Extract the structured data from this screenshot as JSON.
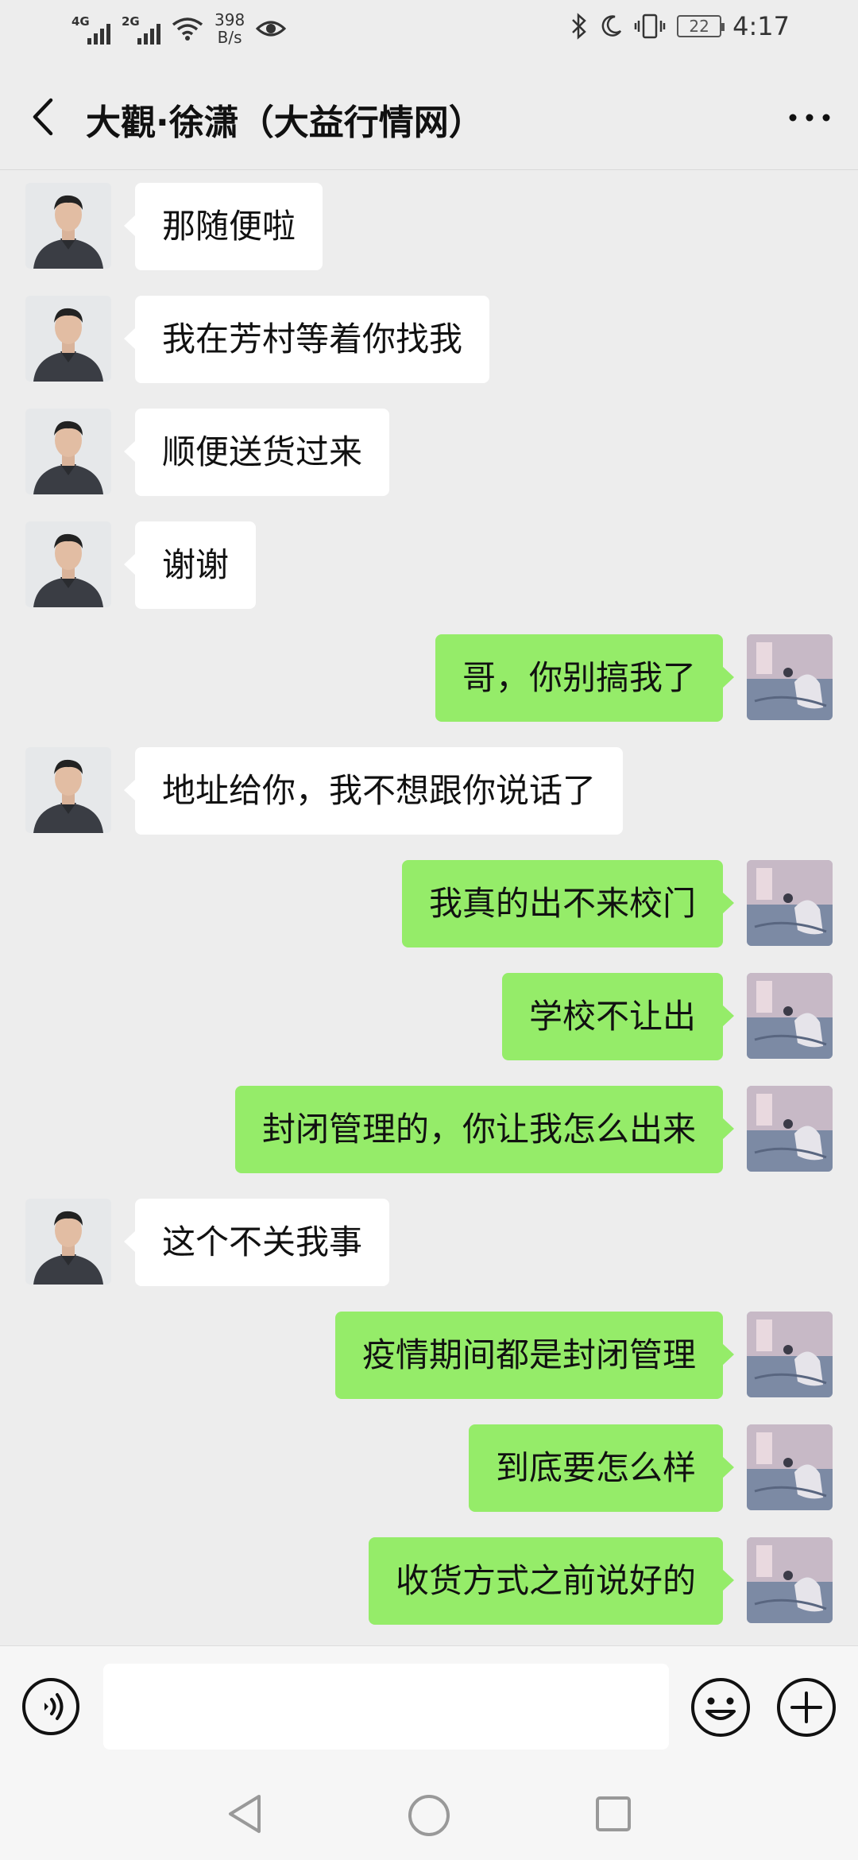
{
  "status_bar": {
    "network_1": "4G",
    "network_2": "2G",
    "speed_value": "398",
    "speed_unit": "B/s",
    "battery": "22",
    "time": "4:17"
  },
  "header": {
    "title": "大觀·徐潇（大益行情网）",
    "back_icon": "chevron-left-icon",
    "more_icon": "more-dots-icon"
  },
  "messages": [
    {
      "side": "left",
      "text": "那随便啦"
    },
    {
      "side": "left",
      "text": "我在芳村等着你找我"
    },
    {
      "side": "left",
      "text": "顺便送货过来"
    },
    {
      "side": "left",
      "text": "谢谢"
    },
    {
      "side": "right",
      "text": "哥，你别搞我了"
    },
    {
      "side": "left",
      "text": "地址给你，我不想跟你说话了"
    },
    {
      "side": "right",
      "text": "我真的出不来校门"
    },
    {
      "side": "right",
      "text": "学校不让出"
    },
    {
      "side": "right",
      "text": "封闭管理的，你让我怎么出来"
    },
    {
      "side": "left",
      "text": "这个不关我事"
    },
    {
      "side": "right",
      "text": "疫情期间都是封闭管理"
    },
    {
      "side": "right",
      "text": "到底要怎么样"
    },
    {
      "side": "right",
      "text": "收货方式之前说好的"
    }
  ],
  "input_bar": {
    "placeholder": "",
    "voice_icon": "voice-icon",
    "emoji_icon": "emoji-icon",
    "plus_icon": "plus-icon"
  },
  "colors": {
    "background": "#ededed",
    "bubble_self": "#95ec69",
    "bubble_other": "#ffffff"
  }
}
